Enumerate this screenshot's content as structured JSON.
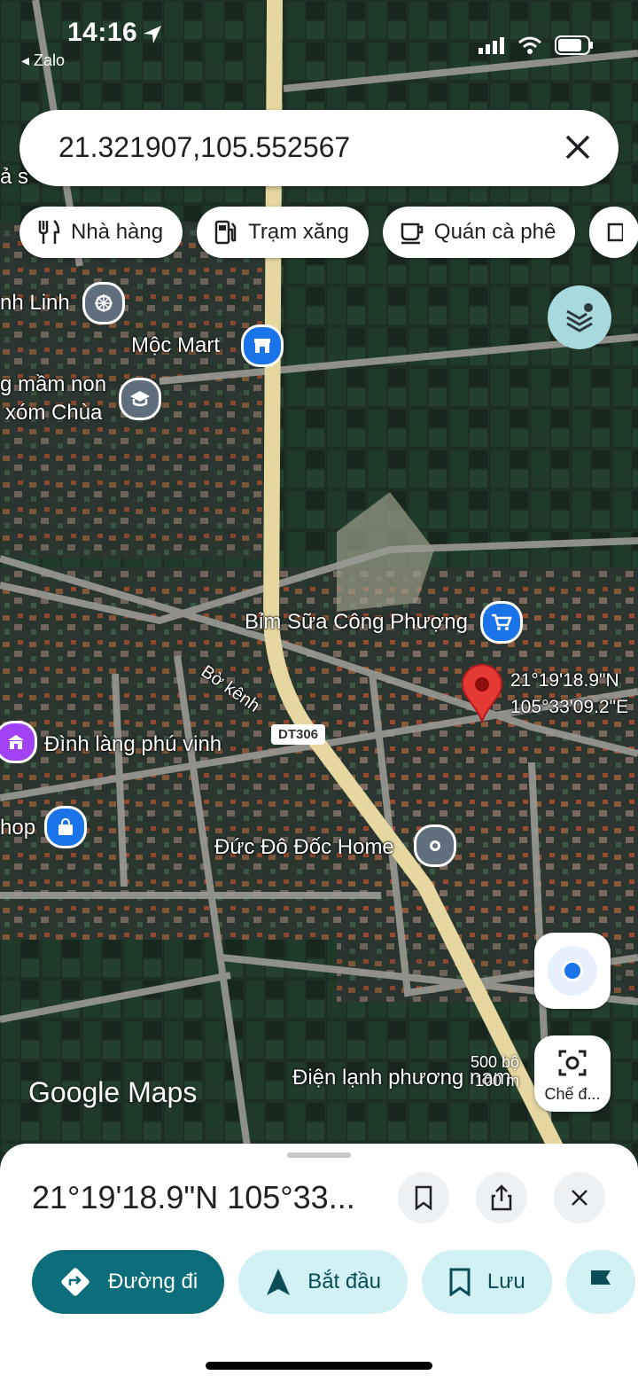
{
  "status_bar": {
    "time": "14:16",
    "back_app": "◂ Zalo"
  },
  "search": {
    "query": "21.321907,105.552567"
  },
  "chips": [
    {
      "icon": "restaurant-icon",
      "label": "Nhà hàng"
    },
    {
      "icon": "gas-station-icon",
      "label": "Trạm xăng"
    },
    {
      "icon": "coffee-icon",
      "label": "Quán cà phê"
    }
  ],
  "map": {
    "road_label": "DT306",
    "pin_label_lat": "21°19'18.9\"N",
    "pin_label_lng": "105°33'09.2\"E",
    "places": {
      "linh": "nh Linh",
      "moc_mart": "Mộc Mart",
      "mam_non_1": "g mầm non",
      "mam_non_2": "xóm Chùa",
      "bim_sua": "Bỉm Sữa Công Phượng",
      "bo_kenh": "Bờ kênh",
      "dinh_lang": "Đình làng phú vinh",
      "shop": "hop",
      "duc_do": "Đức Đô Đốc Home",
      "dien_lanh": "Điện lạnh phương nam",
      "edge_as": "ả s"
    },
    "scale": {
      "feet": "500 bộ",
      "meters": "100 m"
    },
    "logo": "Google Maps"
  },
  "lens": {
    "label": "Chế đ..."
  },
  "sheet": {
    "title": "21°19'18.9\"N 105°33...",
    "actions": [
      {
        "label": "Đường đi"
      },
      {
        "label": "Bắt đầu"
      },
      {
        "label": "Lưu"
      }
    ]
  },
  "colors": {
    "accent": "#0b6e7a",
    "accent_light": "#d2f1f5",
    "pin": "#e53935",
    "poi_blue": "#1a73e8",
    "poi_gray": "#5f6f7e",
    "poi_purple": "#a142f4"
  }
}
